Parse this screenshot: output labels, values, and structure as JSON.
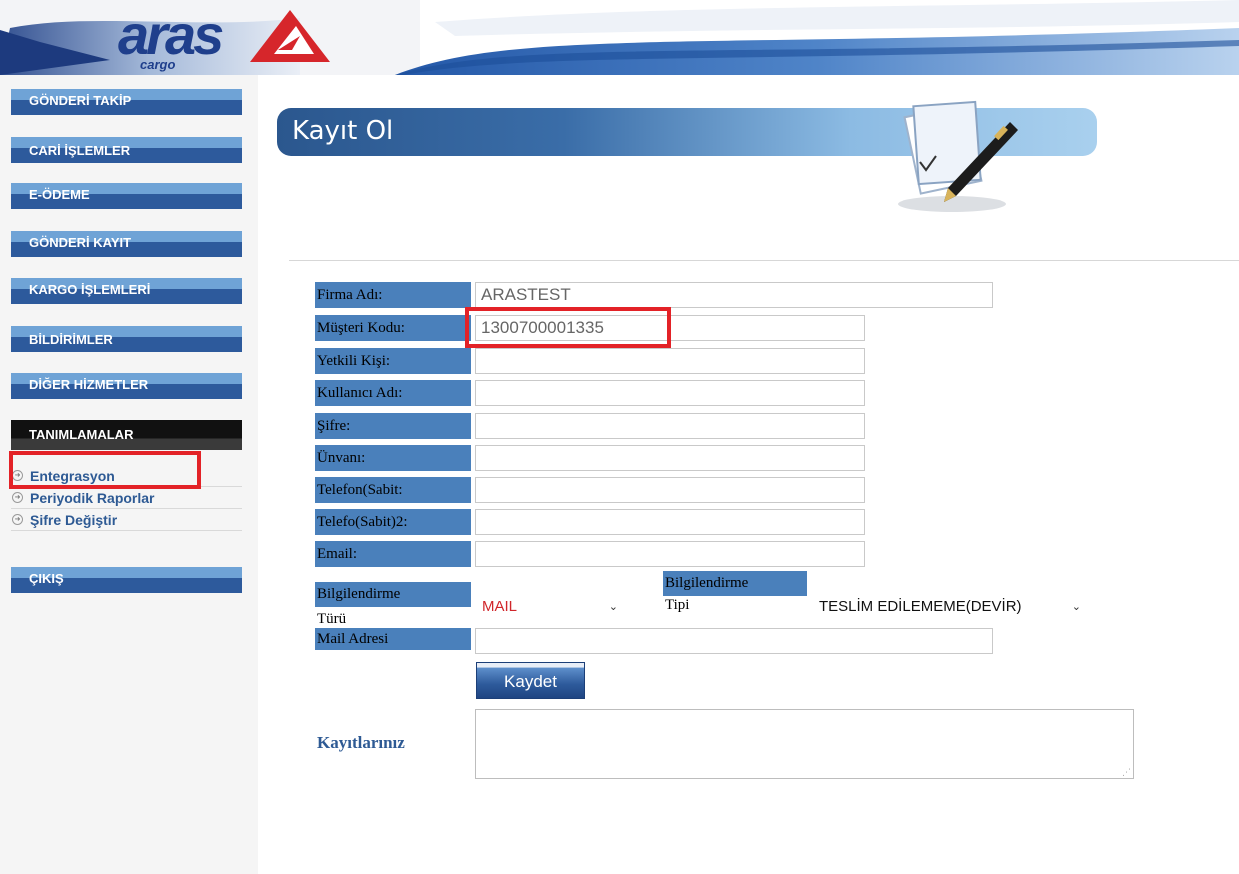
{
  "brand": {
    "logo_text": "aras",
    "logo_sub": "cargo",
    "brand_color": "#1f3f8c",
    "mark_color": "#d6262b"
  },
  "sidebar": {
    "menu": [
      {
        "label": "GÖNDERİ TAKİP"
      },
      {
        "label": "CARİ İŞLEMLER"
      },
      {
        "label": "E-ÖDEME"
      },
      {
        "label": "GÖNDERİ KAYIT"
      },
      {
        "label": "KARGO İŞLEMLERİ"
      },
      {
        "label": "BİLDİRİMLER"
      },
      {
        "label": "DİĞER HİZMETLER"
      }
    ],
    "active_section": "TANIMLAMALAR",
    "sub_items": [
      {
        "label": "Entegrasyon"
      },
      {
        "label": "Periyodik Raporlar"
      },
      {
        "label": "Şifre Değiştir"
      }
    ],
    "exit_label": "ÇIKIŞ"
  },
  "page": {
    "title": "Kayıt Ol"
  },
  "form": {
    "firma_adi": {
      "label": "Firma Adı:",
      "value": "ARASTEST"
    },
    "musteri_kodu": {
      "label": "Müşteri Kodu:",
      "value": "1300700001335"
    },
    "yetkili_kisi": {
      "label": "Yetkili Kişi:",
      "value": ""
    },
    "kullanici_adi": {
      "label": "Kullanıcı Adı:",
      "value": ""
    },
    "sifre": {
      "label": "Şifre:",
      "value": ""
    },
    "unvani": {
      "label": "Ünvanı:",
      "value": ""
    },
    "telefon_sabit": {
      "label": "Telefon(Sabit:",
      "value": ""
    },
    "telefon_sabit2": {
      "label": "Telefo(Sabit)2:",
      "value": ""
    },
    "email": {
      "label": "Email:",
      "value": ""
    },
    "bilgilendirme_turu": {
      "label_line1": "Bilgilendirme",
      "label_line2": "Türü",
      "selected": "MAIL",
      "selected_color": "#d0262b"
    },
    "bilgilendirme_tipi": {
      "label_line1": "Bilgilendirme",
      "label_line2": "Tipi",
      "selected": "TESLİM EDİLEMEME(DEVİR)"
    },
    "mail_adresi": {
      "label": "Mail Adresi",
      "value": ""
    },
    "save_label": "Kaydet",
    "kayitlariniz_label": "Kayıtlarınız",
    "kayitlariniz_value": ""
  },
  "colors": {
    "nav_light": "#6fa3d6",
    "nav_dark": "#2d5a9c",
    "label_bg": "#4a80bb",
    "highlight": "#e32227",
    "link": "#2e5a94"
  }
}
